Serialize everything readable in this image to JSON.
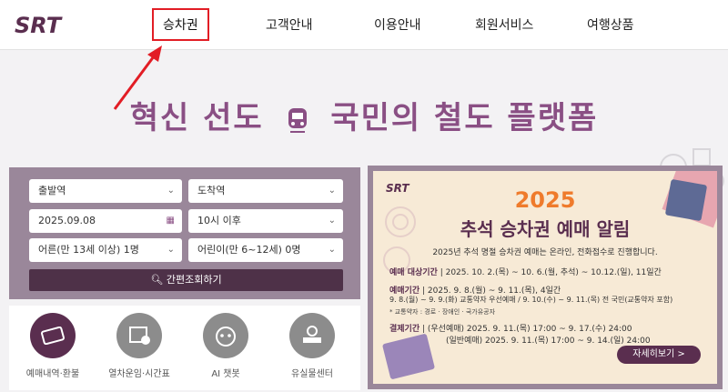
{
  "header": {
    "logo_text": "SRT",
    "nav": [
      "승차권",
      "고객안내",
      "이용안내",
      "회원서비스",
      "여행상품"
    ]
  },
  "hero": {
    "title_left": "혁신 선도",
    "title_right": "국민의 철도 플랫폼"
  },
  "booking": {
    "departure": "출발역",
    "arrival": "도착역",
    "date": "2025.09.08",
    "time": "10시 이후",
    "adult": "어른(만 13세 이상) 1명",
    "child": "어린이(만 6~12세) 0명",
    "search_label": "간편조회하기"
  },
  "quick_menu": [
    {
      "label": "예매내역·환불",
      "icon": "ticket-icon"
    },
    {
      "label": "열차운임·시간표",
      "icon": "timetable-icon"
    },
    {
      "label": "AI 챗봇",
      "icon": "chatbot-icon"
    },
    {
      "label": "유실물센터",
      "icon": "lost-found-icon"
    }
  ],
  "banner": {
    "logo": "SRT",
    "year": "2025",
    "title": "추석 승차권 예매 알림",
    "subtitle": "2025년 추석 명절 승차권 예매는 온라인, 전화접수로 진행합니다.",
    "period_label": "예매 대상기간",
    "period_text": "2025. 10. 2.(목) ~ 10. 6.(월, 추석) ~ 10.12.(일), 11일간",
    "booking_label": "예매기간",
    "booking_text": "2025. 9. 8.(월) ~ 9. 11.(목), 4일간",
    "booking_text2": "9. 8.(월) ~ 9. 9.(화) 교통약자 우선예매 / 9. 10.(수) ~ 9. 11.(목) 전 국민(교통약자 포함)",
    "note": "* 교통약자 : 경로 · 장애인 · 국가유공자",
    "payment_label": "결제기간",
    "payment_text": "(우선예매) 2025. 9. 11.(목) 17:00 ~ 9. 17.(수) 24:00",
    "payment_text2": "(일반예매) 2025. 9. 11.(목) 17:00 ~ 9. 14.(일) 24:00",
    "more_label": "자세히보기 >"
  },
  "colors": {
    "brand_purple": "#5a2e4f",
    "panel_mauve": "#9a879a",
    "highlight_red": "#e21d25",
    "accent_orange": "#ef7b2c"
  }
}
